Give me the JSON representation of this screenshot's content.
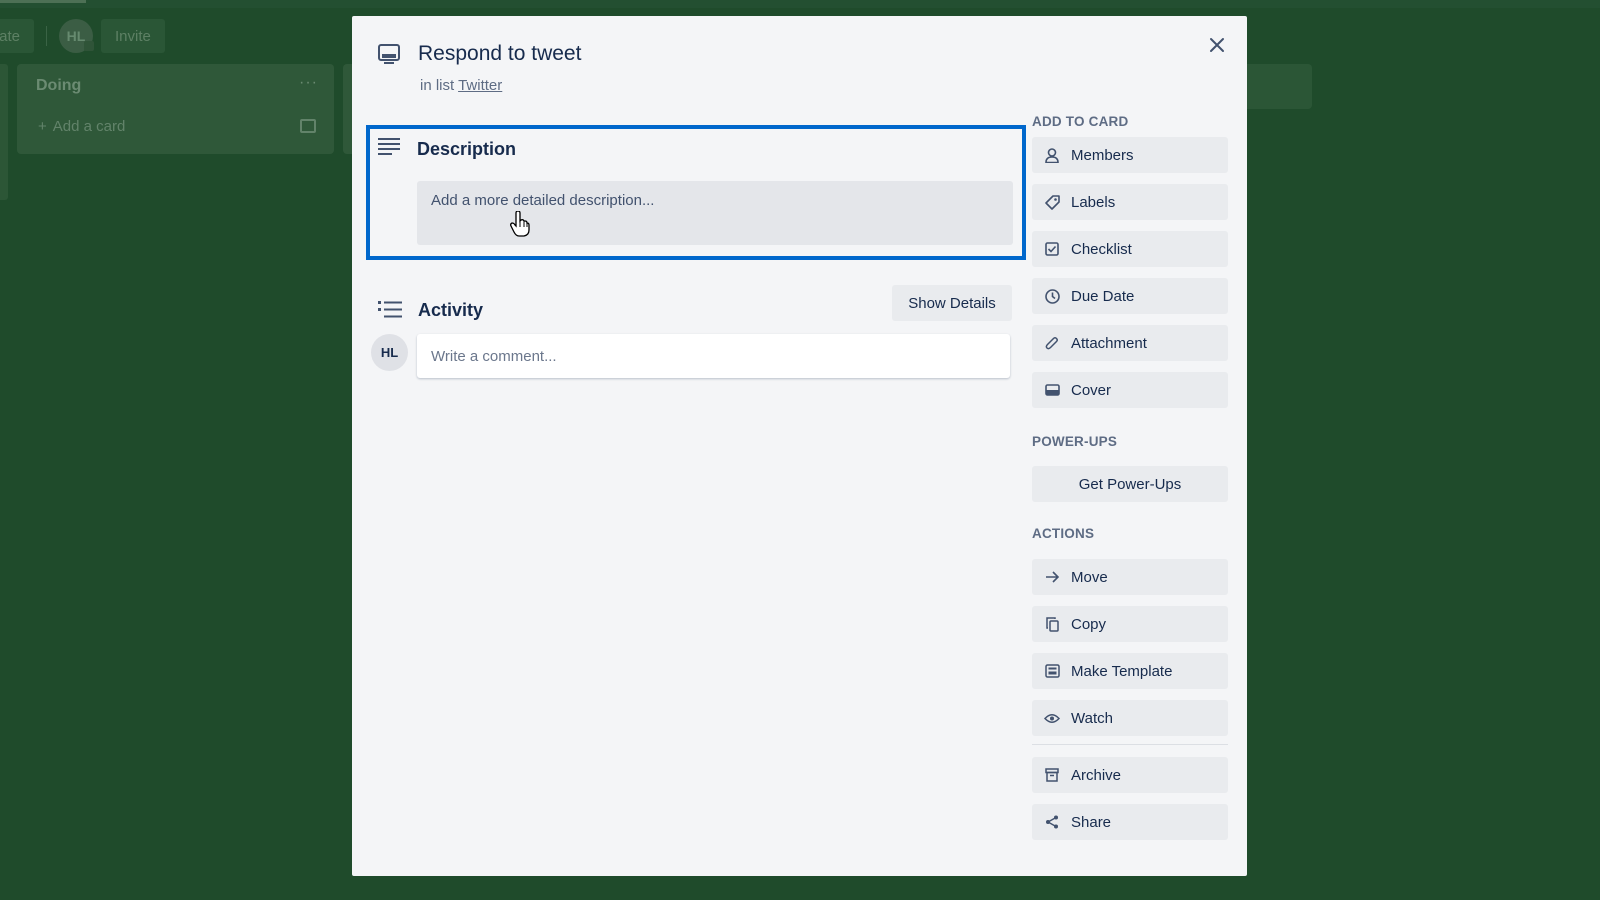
{
  "board": {
    "visibility_label": "vate",
    "member_avatar": "HL",
    "invite_label": "Invite",
    "list": {
      "title": "Doing",
      "menu_label": "···",
      "add_card_label": "Add a card"
    }
  },
  "card": {
    "title": "Respond to tweet",
    "in_list_prefix": "in list",
    "list_name": "Twitter",
    "description": {
      "heading": "Description",
      "placeholder": "Add a more detailed description..."
    },
    "activity": {
      "heading": "Activity",
      "show_details_label": "Show Details",
      "avatar_initials": "HL",
      "comment_placeholder": "Write a comment..."
    }
  },
  "sidebar": {
    "add_to_card_heading": "ADD TO CARD",
    "add_to_card": [
      {
        "label": "Members",
        "icon": "person-icon"
      },
      {
        "label": "Labels",
        "icon": "tag-icon"
      },
      {
        "label": "Checklist",
        "icon": "checkbox-icon"
      },
      {
        "label": "Due Date",
        "icon": "clock-icon"
      },
      {
        "label": "Attachment",
        "icon": "paperclip-icon"
      },
      {
        "label": "Cover",
        "icon": "cover-icon"
      }
    ],
    "power_ups_heading": "POWER-UPS",
    "get_power_ups_label": "Get Power-Ups",
    "actions_heading": "ACTIONS",
    "actions": [
      {
        "label": "Move",
        "icon": "arrow-right-icon"
      },
      {
        "label": "Copy",
        "icon": "copy-icon"
      },
      {
        "label": "Make Template",
        "icon": "template-icon"
      },
      {
        "label": "Watch",
        "icon": "eye-icon"
      }
    ],
    "secondary_actions": [
      {
        "label": "Archive",
        "icon": "archive-icon"
      },
      {
        "label": "Share",
        "icon": "share-icon"
      }
    ]
  },
  "colors": {
    "focus_border": "#0067cc",
    "board_background": "#1f4b2b",
    "modal_background": "#f4f5f7"
  }
}
